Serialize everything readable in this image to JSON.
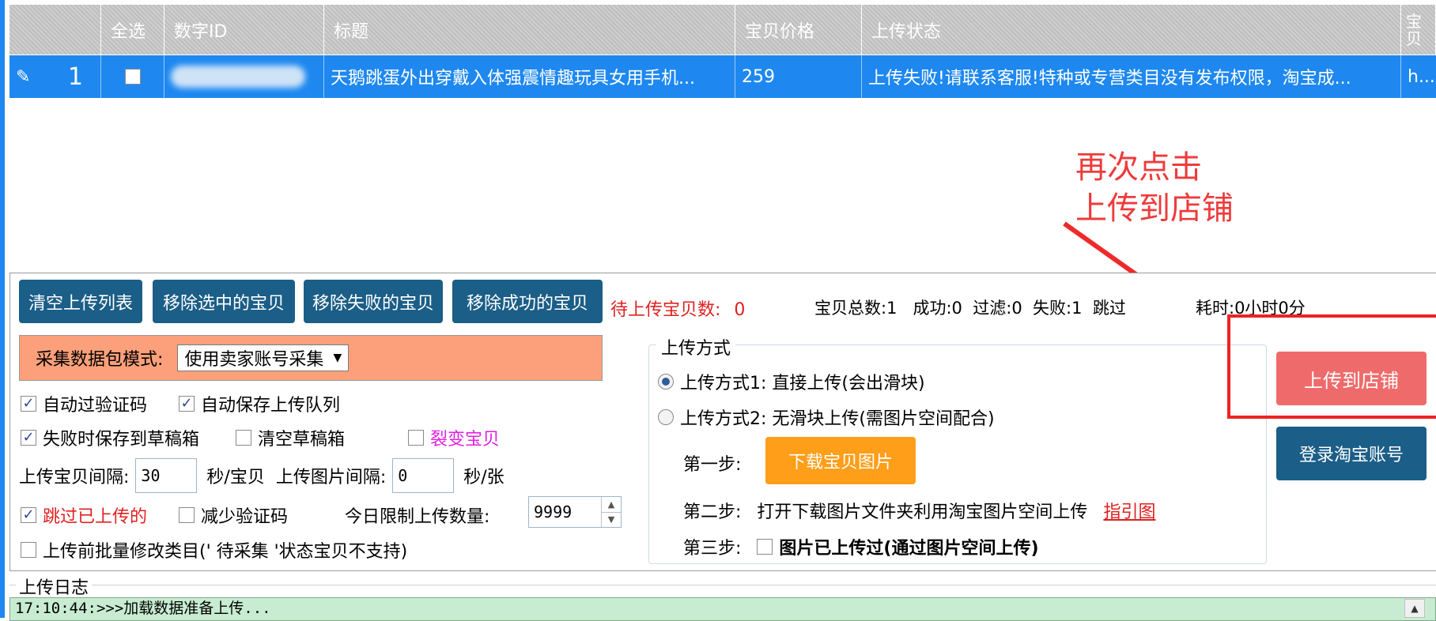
{
  "grid": {
    "headers": {
      "select_all": "全选",
      "id": "数字ID",
      "title": "标题",
      "price": "宝贝价格",
      "status": "上传状态",
      "extra": "宝贝"
    },
    "row": {
      "index": "1",
      "title": "天鹅跳蛋外出穿戴入体强震情趣玩具女用手机...",
      "price": "259",
      "status": "上传失败!请联系客服!特种或专营类目没有发布权限，淘宝成...",
      "extra": "h..."
    }
  },
  "annotation": {
    "line1": "再次点击",
    "line2": "上传到店铺",
    "color": "#ee3b3b"
  },
  "toolbar": {
    "clear_list": "清空上传列表",
    "remove_selected": "移除选中的宝贝",
    "remove_failed": "移除失败的宝贝",
    "remove_success": "移除成功的宝贝",
    "pending_label": "待上传宝贝数:",
    "pending_count": "0",
    "stats": "宝贝总数:1   成功:0  过滤:0  失败:1  跳过",
    "elapsed": "耗时:0小时0分"
  },
  "options": {
    "mode_label": "采集数据包模式:",
    "mode_value": "使用卖家账号采集",
    "auto_captcha": "自动过验证码",
    "auto_save_queue": "自动保存上传队列",
    "save_drafts_on_fail": "失败时保存到草稿箱",
    "clear_drafts": "清空草稿箱",
    "split_items": "裂变宝贝",
    "item_interval_label": "上传宝贝间隔:",
    "item_interval_value": "30",
    "item_interval_unit": "秒/宝贝",
    "image_interval_label": "上传图片间隔:",
    "image_interval_value": "0",
    "image_interval_unit": "秒/张",
    "skip_uploaded": "跳过已上传的",
    "reduce_captcha": "减少验证码",
    "daily_limit_label": "今日限制上传数量:",
    "daily_limit_value": "9999",
    "batch_modify_category": "上传前批量修改类目(' 待采集 '状态宝贝不支持)"
  },
  "upload_method": {
    "legend": "上传方式",
    "method1": "上传方式1: 直接上传(会出滑块)",
    "method2": "上传方式2: 无滑块上传(需图片空间配合)",
    "step1_label": "第一步:",
    "download_images": "下载宝贝图片",
    "step2_label": "第二步:",
    "step2_text": "打开下载图片文件夹利用淘宝图片空间上传",
    "guide_link": "指引图",
    "step3_label": "第三步:",
    "step3_text": "图片已上传过(通过图片空间上传)"
  },
  "actions": {
    "upload_to_store": "上传到店铺",
    "login_taobao": "登录淘宝账号"
  },
  "log": {
    "legend": "上传日志",
    "first_line": "17:10:44:>>>加载数据准备上传..."
  }
}
